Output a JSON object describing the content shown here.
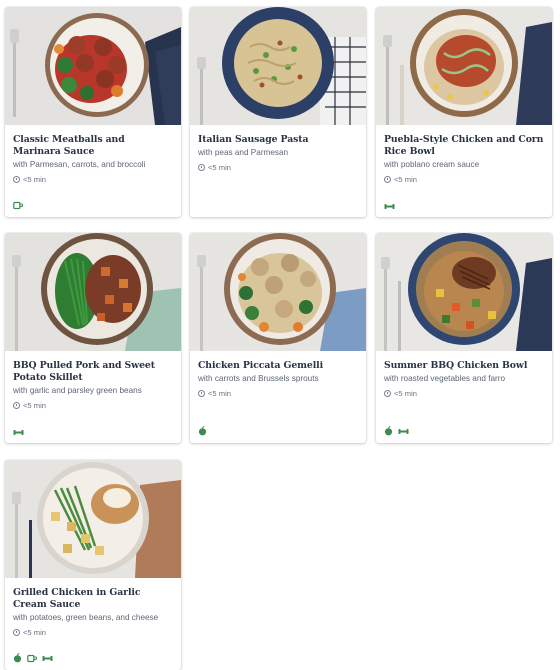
{
  "recipes": [
    {
      "title": "Classic Meatballs and Marinara Sauce",
      "subtitle": "with Parmesan, carrots, and broccoli",
      "time": "<5 min",
      "tags": [
        "mug-icon"
      ]
    },
    {
      "title": "Italian Sausage Pasta",
      "subtitle": "with peas and Parmesan",
      "time": "<5 min",
      "tags": []
    },
    {
      "title": "Puebla-Style Chicken and Corn Rice Bowl",
      "subtitle": "with poblano cream sauce",
      "time": "<5 min",
      "tags": [
        "dumbbell-icon"
      ]
    },
    {
      "title": "BBQ Pulled Pork and Sweet Potato Skillet",
      "subtitle": "with garlic and parsley green beans",
      "time": "<5 min",
      "tags": [
        "dumbbell-icon"
      ]
    },
    {
      "title": "Chicken Piccata Gemelli",
      "subtitle": "with carrots and Brussels sprouts",
      "time": "<5 min",
      "tags": [
        "apple-icon"
      ]
    },
    {
      "title": "Summer BBQ Chicken Bowl",
      "subtitle": "with roasted vegetables and farro",
      "time": "<5 min",
      "tags": [
        "apple-icon",
        "dumbbell-icon"
      ]
    },
    {
      "title": "Grilled Chicken in Garlic Cream Sauce",
      "subtitle": "with potatoes, green beans, and cheese",
      "time": "<5 min",
      "tags": [
        "apple-icon",
        "mug-icon",
        "dumbbell-icon"
      ]
    }
  ],
  "colors": {
    "tag_green": "#3d8b4f",
    "title": "#2a3344",
    "subtitle": "#5d6675"
  }
}
